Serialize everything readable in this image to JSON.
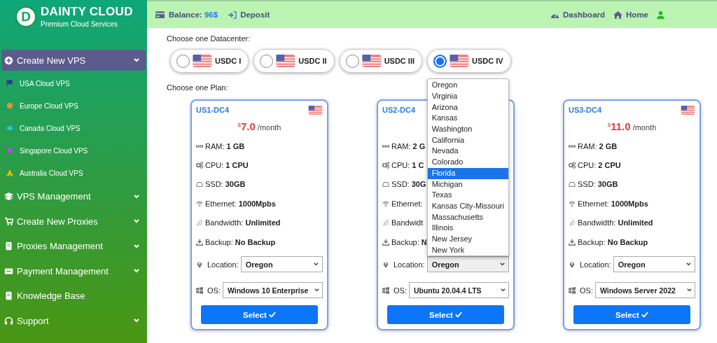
{
  "brand": {
    "initial": "D",
    "name": "DAINTY CLOUD",
    "tagline": "Premium Cloud Services"
  },
  "sidebar": {
    "items": [
      {
        "label": "Create New VPS",
        "kind": "group",
        "selected": true,
        "children": [
          {
            "label": "USA Cloud VPS",
            "color": "#2b3a8c"
          },
          {
            "label": "Europe Cloud VPS",
            "color": "#f08a3c"
          },
          {
            "label": "Canada Cloud VPS",
            "color": "#29c4e6"
          },
          {
            "label": "Singapore Cloud VPS",
            "color": "#9b59d0"
          },
          {
            "label": "Australia Cloud VPS",
            "color": "#f2c200"
          }
        ]
      },
      {
        "label": "VPS Management",
        "kind": "group",
        "selected": false
      },
      {
        "label": "Create New Proxies",
        "kind": "group",
        "selected": false
      },
      {
        "label": "Proxies Management",
        "kind": "group",
        "selected": false
      },
      {
        "label": "Payment Management",
        "kind": "group",
        "selected": false
      },
      {
        "label": "Knowledge Base",
        "kind": "link",
        "selected": false
      },
      {
        "label": "Support",
        "kind": "group",
        "selected": false
      }
    ]
  },
  "topbar": {
    "balance_label": "Balance:",
    "balance_value": "96$",
    "deposit": "Deposit",
    "dashboard": "Dashboard",
    "home": "Home"
  },
  "datacenter_heading": "Choose one Datacenter:",
  "datacenters": [
    {
      "label": "USDC I",
      "selected": false
    },
    {
      "label": "USDC II",
      "selected": false
    },
    {
      "label": "USDC III",
      "selected": false
    },
    {
      "label": "USDC IV",
      "selected": true
    }
  ],
  "plan_heading": "Choose one Plan:",
  "plans": [
    {
      "name": "US1-DC4",
      "currency": "$",
      "amount": "7.0",
      "period": "/month",
      "specs": [
        {
          "kind": "ram",
          "label": "RAM:",
          "value": "1 GB"
        },
        {
          "kind": "cpu",
          "label": "CPU:",
          "value": "1 CPU"
        },
        {
          "kind": "ssd",
          "label": "SSD:",
          "value": "30GB"
        },
        {
          "kind": "ethernet",
          "label": "Ethernet:",
          "value": "1000Mpbs"
        },
        {
          "kind": "bandwidth",
          "label": "Bandwidth:",
          "value": "Unlimited"
        },
        {
          "kind": "backup",
          "label": "Backup:",
          "value": "No Backup"
        }
      ],
      "location_label": "Location:",
      "location": "Oregon",
      "os_label": "OS:",
      "os": "Windows 10 Enterprise",
      "button": "Select"
    },
    {
      "name": "US2-DC4",
      "specs": [
        {
          "kind": "ram",
          "label": "RAM:",
          "value": "2 G"
        },
        {
          "kind": "cpu",
          "label": "CPU:",
          "value": "1 C"
        },
        {
          "kind": "ssd",
          "label": "SSD:",
          "value": "30G"
        },
        {
          "kind": "ethernet",
          "label": "Ethernet:"
        },
        {
          "kind": "bandwidth",
          "label": "Bandwidt"
        },
        {
          "kind": "backup",
          "label": "Backup:",
          "value": "N"
        }
      ],
      "location_label": "Location:",
      "location": "Oregon",
      "os_label": "OS:",
      "os": "Ubuntu 20.04.4 LTS",
      "button": "Select",
      "location_options": [
        {
          "label": "Oregon",
          "selected": false
        },
        {
          "label": "Virginia",
          "selected": false
        },
        {
          "label": "Arizona",
          "selected": false
        },
        {
          "label": "Kansas",
          "selected": false
        },
        {
          "label": "Washington",
          "selected": false
        },
        {
          "label": "California",
          "selected": false
        },
        {
          "label": "Nevada",
          "selected": false
        },
        {
          "label": "Colorado",
          "selected": false
        },
        {
          "label": "Florida",
          "selected": true
        },
        {
          "label": "Michigan",
          "selected": false
        },
        {
          "label": "Texas",
          "selected": false
        },
        {
          "label": "Kansas City-Missouri",
          "selected": false
        },
        {
          "label": "Massachusetts",
          "selected": false
        },
        {
          "label": "Illinois",
          "selected": false
        },
        {
          "label": "New Jersey",
          "selected": false
        },
        {
          "label": "New York",
          "selected": false
        }
      ]
    },
    {
      "name": "US3-DC4",
      "currency": "$",
      "amount": "11.0",
      "period": "/month",
      "specs": [
        {
          "kind": "ram",
          "label": "RAM:",
          "value": "2 GB"
        },
        {
          "kind": "cpu",
          "label": "CPU:",
          "value": "2 CPU"
        },
        {
          "kind": "ssd",
          "label": "SSD:",
          "value": "30GB"
        },
        {
          "kind": "ethernet",
          "label": "Ethernet:",
          "value": "1000Mpbs"
        },
        {
          "kind": "bandwidth",
          "label": "Bandwidth:",
          "value": "Unlimited"
        },
        {
          "kind": "backup",
          "label": "Backup:",
          "value": "No Backup"
        }
      ],
      "location_label": "Location:",
      "location": "Oregon",
      "os_label": "OS:",
      "os": "Windows Server 2022",
      "button": "Select"
    }
  ]
}
